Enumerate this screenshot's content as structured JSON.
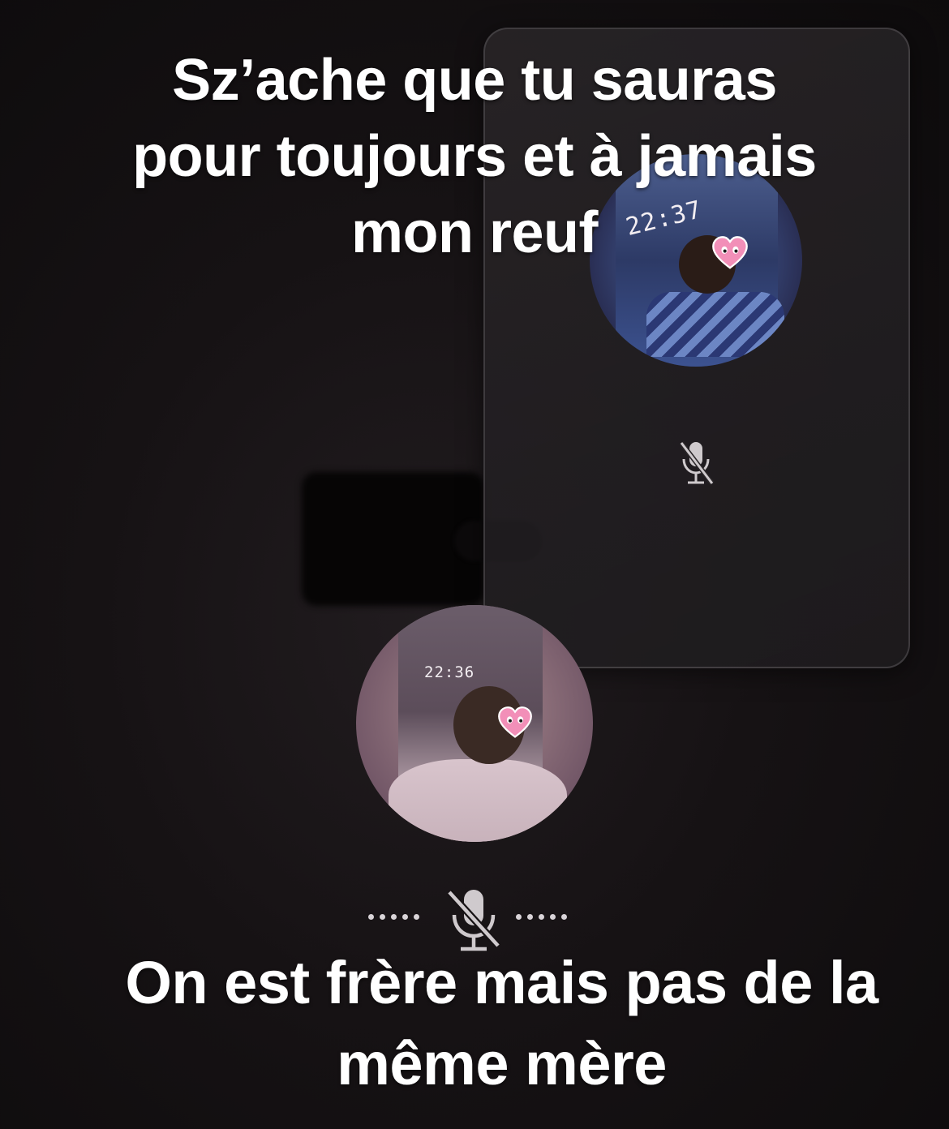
{
  "caption_top": {
    "lines": [
      "Sz’ache que tu sauras",
      "pour toujours et à jamais",
      "mon reuf"
    ]
  },
  "caption_bottom": {
    "lines": [
      "On est frère mais pas de la",
      "même mère"
    ]
  },
  "remote_participant": {
    "clock_text": "22:37",
    "sticker": "pink-heart-sticker",
    "mic_status": "muted",
    "mic_icon": "mic-off-icon"
  },
  "local_participant": {
    "clock_text": "22:36",
    "sticker": "pink-heart-sticker",
    "mic_status": "muted",
    "mic_icon": "mic-off-icon"
  },
  "colors": {
    "background": "#161214",
    "caption_text": "#ffffff",
    "heart_pink": "#f28fb8",
    "icon_gray": "#cfcacd"
  }
}
